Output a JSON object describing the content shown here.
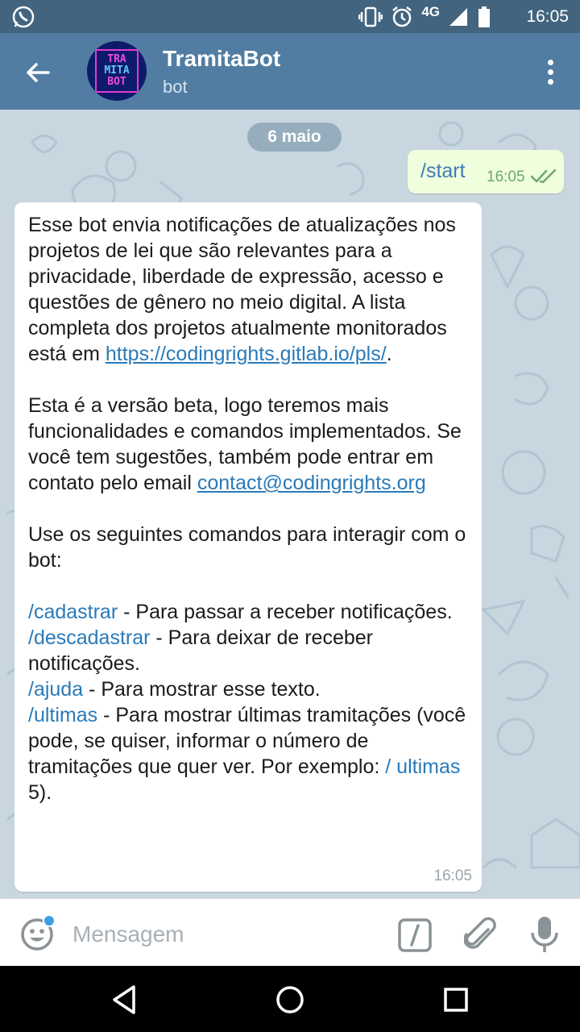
{
  "status_bar": {
    "network": "4G",
    "time": "16:05",
    "icons": [
      "whatsapp-icon",
      "vibrate-icon",
      "alarm-icon",
      "signal-icon",
      "battery-icon"
    ]
  },
  "header": {
    "title": "TramitaBot",
    "subtitle": "bot",
    "avatar_text": [
      "TRA",
      "MITA",
      "BOT"
    ]
  },
  "chat": {
    "date_separator": "6 maio",
    "outgoing": {
      "text": "/start",
      "time": "16:05",
      "status": "read"
    },
    "incoming": {
      "time": "16:05",
      "p1": "Esse bot envia notificações de atualizações nos projetos de lei que são relevantes para a privacidade, liberdade de expressão, acesso e questões de gênero no meio digital. A lista completa dos projetos atualmente monitorados está em ",
      "p1_link": "https://codingrights.gitlab.io/pls/",
      "p1_end": ".",
      "p2": "Esta é a versão beta, logo teremos mais funcionalidades e comandos implementados. Se você tem sugestões, também pode entrar em contato pelo email ",
      "p2_link": "contact@codingrights.org",
      "p3": "Use os seguintes comandos para interagir com o bot:",
      "commands": [
        {
          "cmd": "/cadastrar",
          "desc": " - Para passar a receber notificações."
        },
        {
          "cmd": "/descadastrar",
          "desc": " - Para deixar de receber notificações."
        },
        {
          "cmd": "/ajuda",
          "desc": " - Para mostrar esse texto."
        },
        {
          "cmd": "/ultimas",
          "desc": " - Para mostrar últimas tramitações (você pode, se quiser, informar o número de tramitações que quer ver. Por exemplo: "
        }
      ],
      "example_cmd": "/ ultimas",
      "example_end": " 5)."
    }
  },
  "input_bar": {
    "placeholder": "Mensagem"
  },
  "colors": {
    "header": "#517da2",
    "status_bar": "#42647f",
    "outgoing_bubble": "#effedd",
    "link": "#2a7ab8"
  }
}
